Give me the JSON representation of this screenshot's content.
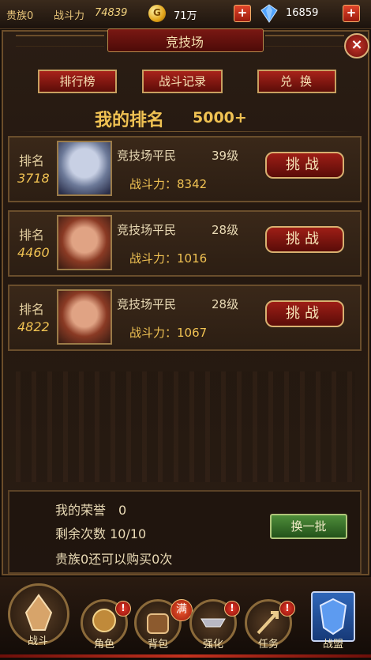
{
  "topbar": {
    "noble": "贵族0",
    "power_label": "战斗力",
    "power_value": "74839",
    "gold": "71万",
    "gems": "16859",
    "plus": "+"
  },
  "panel": {
    "title": "竞技场",
    "close": "×",
    "tabs": [
      "排行榜",
      "战斗记录",
      "兑换"
    ],
    "my_rank_label": "我的排名",
    "my_rank_value": "5000+"
  },
  "rows": [
    {
      "rank_label": "排名",
      "rank": "3718",
      "name": "竞技场平民",
      "level": "39级",
      "power": "战斗力：8342",
      "button": "挑战"
    },
    {
      "rank_label": "排名",
      "rank": "4460",
      "name": "竞技场平民",
      "level": "28级",
      "power": "战斗力：1016",
      "button": "挑战"
    },
    {
      "rank_label": "排名",
      "rank": "4822",
      "name": "竞技场平民",
      "level": "28级",
      "power": "战斗力：1067",
      "button": "挑战"
    }
  ],
  "info": {
    "honor": "我的荣誉　0",
    "remaining": "剩余次数 10/10",
    "noble_buy": "贵族0还可以购买0次",
    "refresh_button": "换一批"
  },
  "nav": {
    "items": [
      "战斗",
      "角色",
      "背包",
      "强化",
      "任务",
      "战盟"
    ],
    "full_badge": "满",
    "badge": "!"
  }
}
